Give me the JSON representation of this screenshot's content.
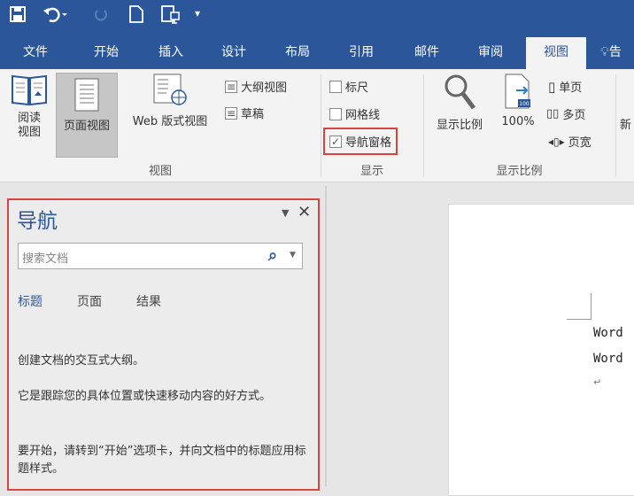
{
  "quick_access": {
    "save": "save-icon",
    "undo": "undo-icon",
    "redo": "redo-icon",
    "new": "new-document-icon",
    "touch": "touch-mode-icon",
    "customize": "customize-dropdown-icon"
  },
  "tabs": [
    "文件",
    "开始",
    "插入",
    "设计",
    "布局",
    "引用",
    "邮件",
    "审阅",
    "视图"
  ],
  "active_tab": "视图",
  "tell_me_icon": "lightbulb-icon",
  "tell_me_text": "告",
  "ribbon": {
    "views": {
      "label": "视图",
      "read": "阅读\n视图",
      "print": "页面视图",
      "web": "Web 版式视图",
      "outline": "大纲视图",
      "draft": "草稿"
    },
    "show": {
      "label": "显示",
      "ruler": "标尺",
      "gridlines": "网格线",
      "nav_pane": "导航窗格",
      "ruler_checked": false,
      "gridlines_checked": false,
      "nav_pane_checked": true
    },
    "zoom": {
      "label": "显示比例",
      "zoom": "显示比例",
      "hundred": "100%",
      "one_page": "单页",
      "multi_page": "多页",
      "page_width": "页宽",
      "hundred_badge": "100"
    },
    "new_window": "新"
  },
  "nav_pane": {
    "title": "导航",
    "search_placeholder": "搜索文档",
    "tabs": [
      "标题",
      "页面",
      "结果"
    ],
    "active_tab": "标题",
    "msg1": "创建文档的交互式大纲。",
    "msg2": "它是跟踪您的具体位置或快速移动内容的好方式。",
    "msg3": "要开始，请转到“开始”选项卡，并向文档中的标题应用标题样式。"
  },
  "document": {
    "lines": [
      "Word",
      "Word"
    ],
    "para_mark": "↵"
  },
  "colors": {
    "accent": "#2b579a",
    "highlight": "#d9443a"
  }
}
